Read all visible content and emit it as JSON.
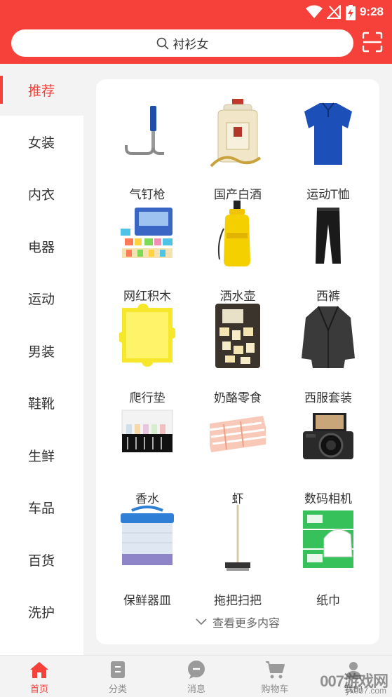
{
  "status_bar": {
    "time": "9:28"
  },
  "search": {
    "query": "衬衫女"
  },
  "sidebar": {
    "items": [
      {
        "label": "推荐",
        "active": true
      },
      {
        "label": "女装"
      },
      {
        "label": "内衣"
      },
      {
        "label": "电器"
      },
      {
        "label": "运动"
      },
      {
        "label": "男装"
      },
      {
        "label": "鞋靴"
      },
      {
        "label": "生鲜"
      },
      {
        "label": "车品"
      },
      {
        "label": "百货"
      },
      {
        "label": "洗护"
      }
    ]
  },
  "grid": {
    "items": [
      {
        "label": "气钉枪",
        "icon": "nail-gun-icon"
      },
      {
        "label": "国产白酒",
        "icon": "liquor-bottle-icon"
      },
      {
        "label": "运动T恤",
        "icon": "tshirt-icon"
      },
      {
        "label": "网红积木",
        "icon": "building-blocks-icon"
      },
      {
        "label": "洒水壶",
        "icon": "sprayer-icon"
      },
      {
        "label": "西裤",
        "icon": "trousers-icon"
      },
      {
        "label": "爬行垫",
        "icon": "crawling-mat-icon"
      },
      {
        "label": "奶酪零食",
        "icon": "cheese-snack-icon"
      },
      {
        "label": "西服套装",
        "icon": "suit-jacket-icon"
      },
      {
        "label": "香水",
        "icon": "perfume-set-icon"
      },
      {
        "label": "虾",
        "icon": "shrimp-icon"
      },
      {
        "label": "数码相机",
        "icon": "camera-icon"
      },
      {
        "label": "保鲜器皿",
        "icon": "storage-box-icon"
      },
      {
        "label": "拖把扫把",
        "icon": "mop-icon"
      },
      {
        "label": "纸巾",
        "icon": "tissue-icon"
      }
    ],
    "more_label": "查看更多内容"
  },
  "bottom_nav": {
    "tabs": [
      {
        "label": "首页",
        "active": true
      },
      {
        "label": "分类"
      },
      {
        "label": "消息"
      },
      {
        "label": "购物车"
      },
      {
        "label": "我的"
      }
    ]
  },
  "watermark": {
    "main": "007游戏网",
    "sub": "yx007.com"
  },
  "colors": {
    "accent": "#f6413a",
    "background": "#f3f3f3",
    "panel": "#ffffff"
  }
}
